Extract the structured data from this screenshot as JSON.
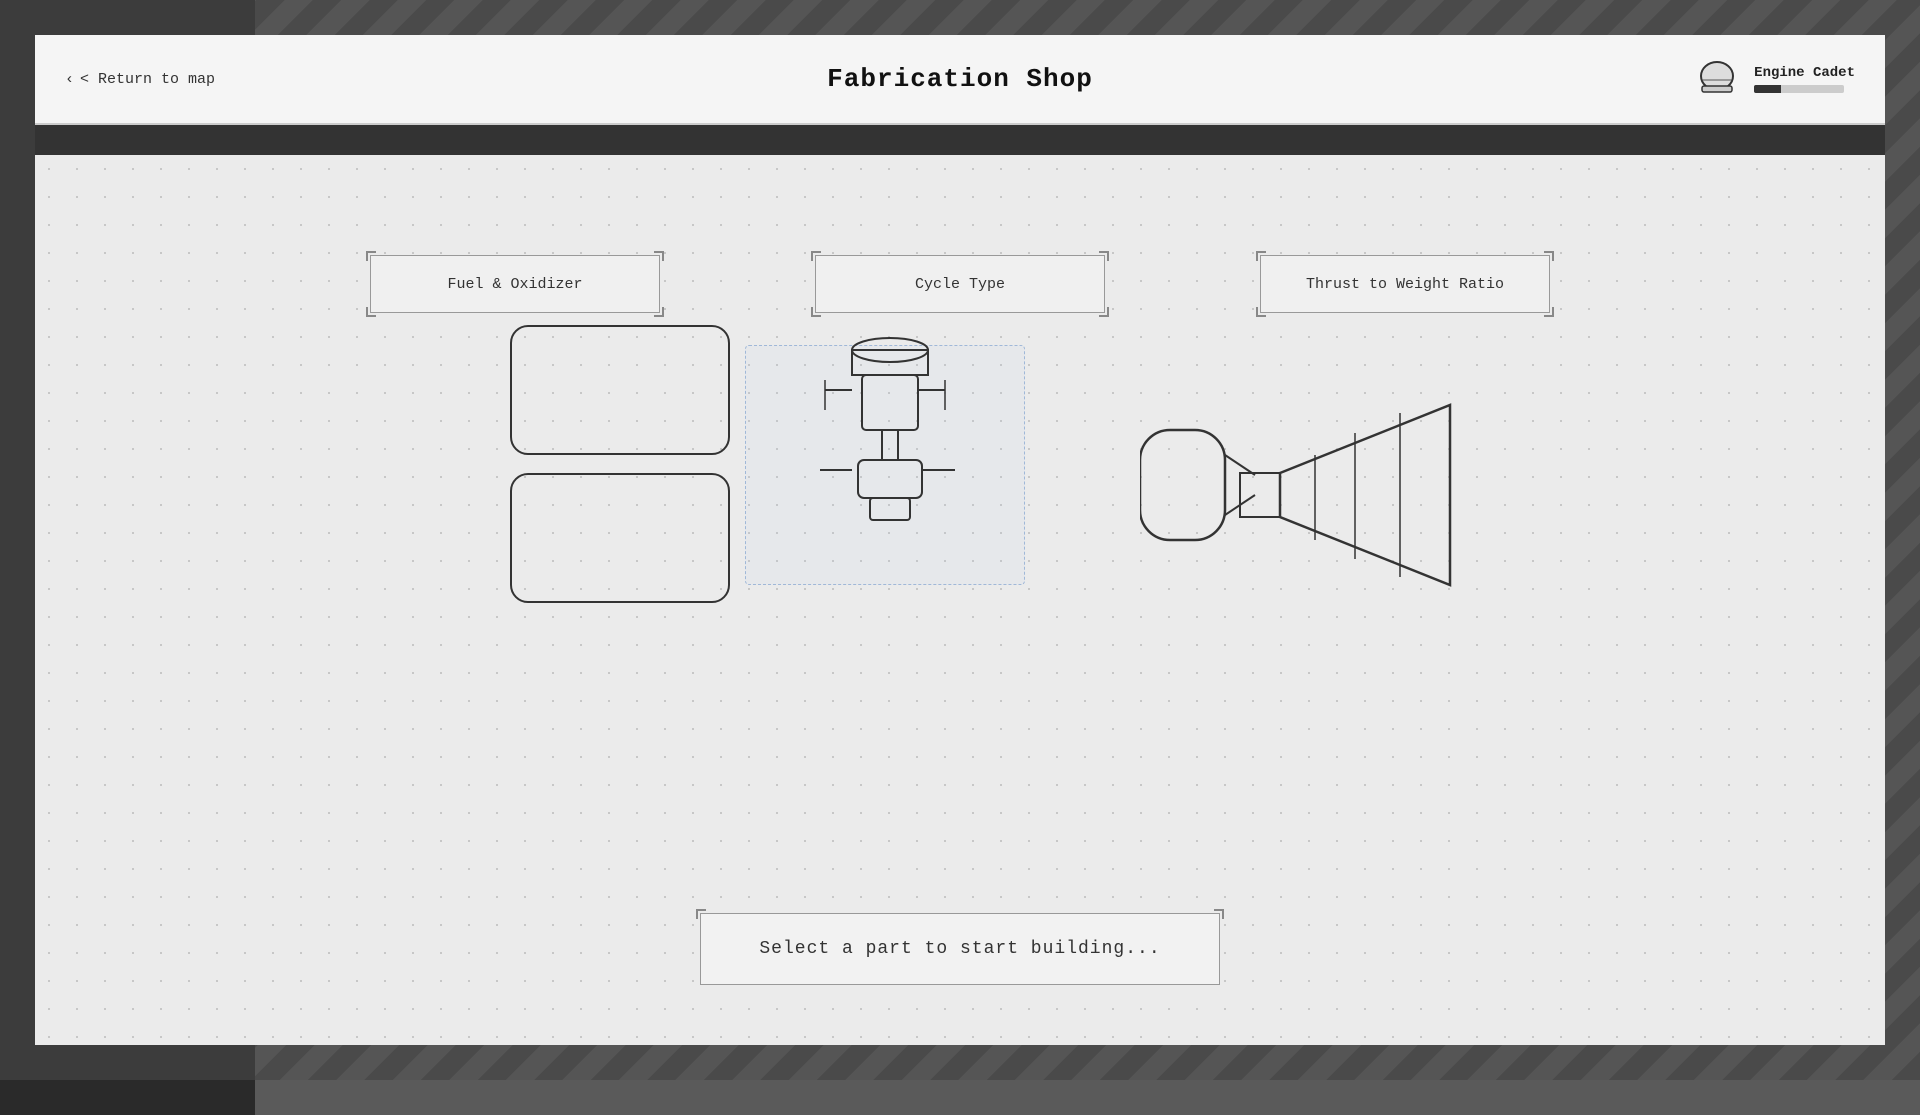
{
  "header": {
    "return_label": "< Return to map",
    "title": "Fabrication Shop",
    "user": {
      "name": "Engine Cadet",
      "progress_pct": 30
    }
  },
  "categories": [
    {
      "id": "fuel-oxidizer",
      "label": "Fuel & Oxidizer"
    },
    {
      "id": "cycle-type",
      "label": "Cycle Type"
    },
    {
      "id": "thrust-weight",
      "label": "Thrust to Weight Ratio"
    }
  ],
  "status": {
    "message": "Select a part to start building..."
  }
}
